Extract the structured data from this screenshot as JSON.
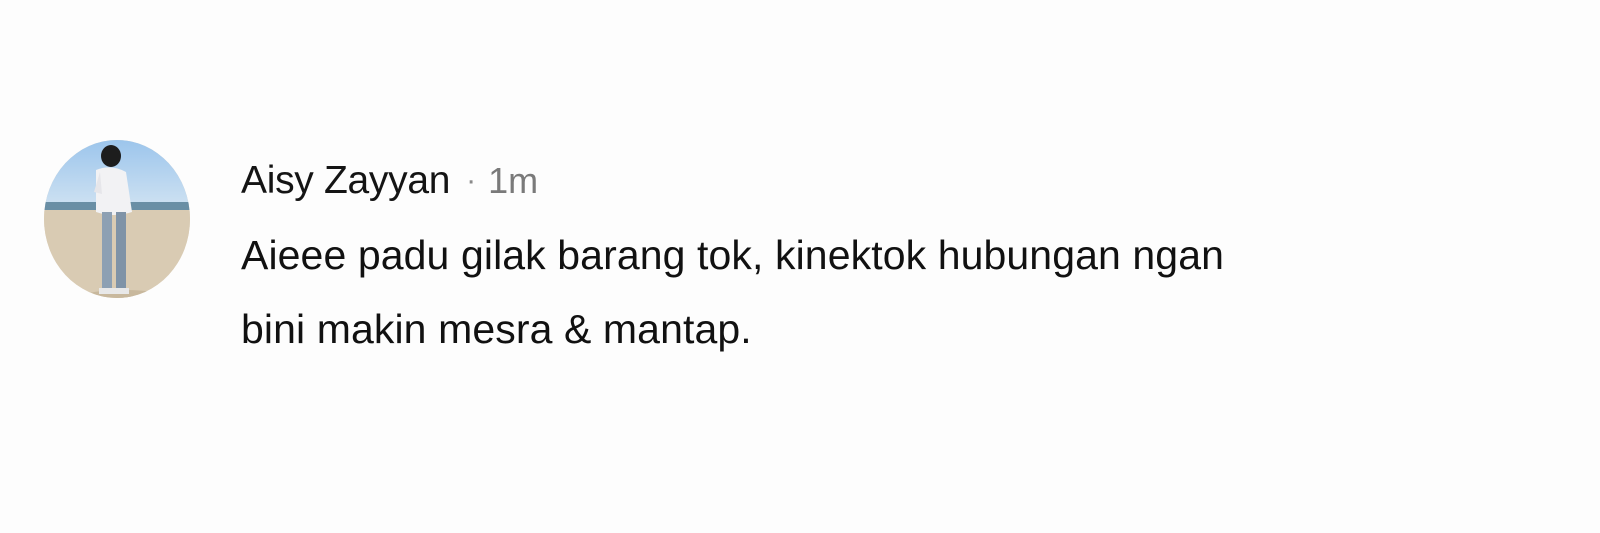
{
  "comment": {
    "author": "Aisy Zayyan",
    "separator": "·",
    "time": "1m",
    "text_lines": [
      "Aieee padu gilak barang tok, kinektok hubungan ngan",
      "bini makin mesra & mantap."
    ]
  }
}
